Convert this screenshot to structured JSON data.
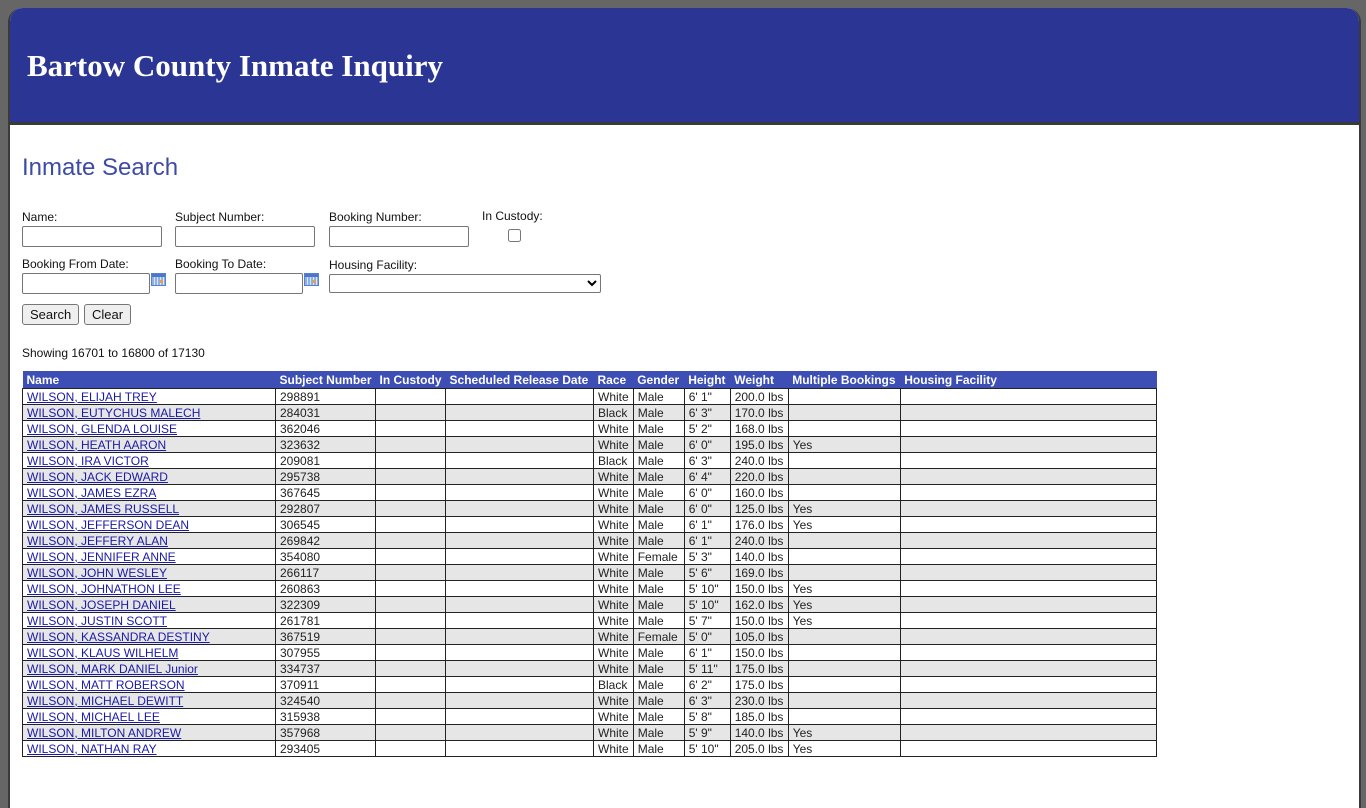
{
  "header": {
    "title": "Bartow County Inmate Inquiry"
  },
  "page_title": "Inmate Search",
  "form": {
    "name_label": "Name:",
    "name_value": "",
    "subject_label": "Subject Number:",
    "subject_value": "",
    "booking_label": "Booking Number:",
    "booking_value": "",
    "custody_label": "In Custody:",
    "custody_checked": false,
    "from_label": "Booking From Date:",
    "from_value": "",
    "to_label": "Booking To Date:",
    "to_value": "",
    "facility_label": "Housing Facility:",
    "facility_selected": "",
    "search_button": "Search",
    "clear_button": "Clear"
  },
  "showing": "Showing 16701 to 16800 of 17130",
  "table": {
    "columns": [
      "Name",
      "Subject Number",
      "In Custody",
      "Scheduled Release Date",
      "Race",
      "Gender",
      "Height",
      "Weight",
      "Multiple Bookings",
      "Housing Facility"
    ],
    "rows": [
      {
        "name": "WILSON, ELIJAH TREY",
        "subject": "298891",
        "custody": "",
        "release": "",
        "race": "White",
        "gender": "Male",
        "height": "6' 1\"",
        "weight": "200.0 lbs",
        "multiple": "",
        "facility": ""
      },
      {
        "name": "WILSON, EUTYCHUS MALECH",
        "subject": "284031",
        "custody": "",
        "release": "",
        "race": "Black",
        "gender": "Male",
        "height": "6' 3\"",
        "weight": "170.0 lbs",
        "multiple": "",
        "facility": ""
      },
      {
        "name": "WILSON, GLENDA LOUISE",
        "subject": "362046",
        "custody": "",
        "release": "",
        "race": "White",
        "gender": "Male",
        "height": "5' 2\"",
        "weight": "168.0 lbs",
        "multiple": "",
        "facility": ""
      },
      {
        "name": "WILSON, HEATH AARON",
        "subject": "323632",
        "custody": "",
        "release": "",
        "race": "White",
        "gender": "Male",
        "height": "6' 0\"",
        "weight": "195.0 lbs",
        "multiple": "Yes",
        "facility": ""
      },
      {
        "name": "WILSON, IRA VICTOR",
        "subject": "209081",
        "custody": "",
        "release": "",
        "race": "Black",
        "gender": "Male",
        "height": "6' 3\"",
        "weight": "240.0 lbs",
        "multiple": "",
        "facility": ""
      },
      {
        "name": "WILSON, JACK EDWARD",
        "subject": "295738",
        "custody": "",
        "release": "",
        "race": "White",
        "gender": "Male",
        "height": "6' 4\"",
        "weight": "220.0 lbs",
        "multiple": "",
        "facility": ""
      },
      {
        "name": "WILSON, JAMES EZRA",
        "subject": "367645",
        "custody": "",
        "release": "",
        "race": "White",
        "gender": "Male",
        "height": "6' 0\"",
        "weight": "160.0 lbs",
        "multiple": "",
        "facility": ""
      },
      {
        "name": "WILSON, JAMES RUSSELL",
        "subject": "292807",
        "custody": "",
        "release": "",
        "race": "White",
        "gender": "Male",
        "height": "6' 0\"",
        "weight": "125.0 lbs",
        "multiple": "Yes",
        "facility": ""
      },
      {
        "name": "WILSON, JEFFERSON DEAN",
        "subject": "306545",
        "custody": "",
        "release": "",
        "race": "White",
        "gender": "Male",
        "height": "6' 1\"",
        "weight": "176.0 lbs",
        "multiple": "Yes",
        "facility": ""
      },
      {
        "name": "WILSON, JEFFERY ALAN",
        "subject": "269842",
        "custody": "",
        "release": "",
        "race": "White",
        "gender": "Male",
        "height": "6' 1\"",
        "weight": "240.0 lbs",
        "multiple": "",
        "facility": ""
      },
      {
        "name": "WILSON, JENNIFER ANNE",
        "subject": "354080",
        "custody": "",
        "release": "",
        "race": "White",
        "gender": "Female",
        "height": "5' 3\"",
        "weight": "140.0 lbs",
        "multiple": "",
        "facility": ""
      },
      {
        "name": "WILSON, JOHN WESLEY",
        "subject": "266117",
        "custody": "",
        "release": "",
        "race": "White",
        "gender": "Male",
        "height": "5' 6\"",
        "weight": "169.0 lbs",
        "multiple": "",
        "facility": ""
      },
      {
        "name": "WILSON, JOHNATHON LEE",
        "subject": "260863",
        "custody": "",
        "release": "",
        "race": "White",
        "gender": "Male",
        "height": "5' 10\"",
        "weight": "150.0 lbs",
        "multiple": "Yes",
        "facility": ""
      },
      {
        "name": "WILSON, JOSEPH DANIEL",
        "subject": "322309",
        "custody": "",
        "release": "",
        "race": "White",
        "gender": "Male",
        "height": "5' 10\"",
        "weight": "162.0 lbs",
        "multiple": "Yes",
        "facility": ""
      },
      {
        "name": "WILSON, JUSTIN SCOTT",
        "subject": "261781",
        "custody": "",
        "release": "",
        "race": "White",
        "gender": "Male",
        "height": "5' 7\"",
        "weight": "150.0 lbs",
        "multiple": "Yes",
        "facility": ""
      },
      {
        "name": "WILSON, KASSANDRA DESTINY",
        "subject": "367519",
        "custody": "",
        "release": "",
        "race": "White",
        "gender": "Female",
        "height": "5' 0\"",
        "weight": "105.0 lbs",
        "multiple": "",
        "facility": ""
      },
      {
        "name": "WILSON, KLAUS WILHELM",
        "subject": "307955",
        "custody": "",
        "release": "",
        "race": "White",
        "gender": "Male",
        "height": "6' 1\"",
        "weight": "150.0 lbs",
        "multiple": "",
        "facility": ""
      },
      {
        "name": "WILSON, MARK DANIEL Junior",
        "subject": "334737",
        "custody": "",
        "release": "",
        "race": "White",
        "gender": "Male",
        "height": "5' 11\"",
        "weight": "175.0 lbs",
        "multiple": "",
        "facility": ""
      },
      {
        "name": "WILSON, MATT ROBERSON",
        "subject": "370911",
        "custody": "",
        "release": "",
        "race": "Black",
        "gender": "Male",
        "height": "6' 2\"",
        "weight": "175.0 lbs",
        "multiple": "",
        "facility": ""
      },
      {
        "name": "WILSON, MICHAEL DEWITT",
        "subject": "324540",
        "custody": "",
        "release": "",
        "race": "White",
        "gender": "Male",
        "height": "6' 3\"",
        "weight": "230.0 lbs",
        "multiple": "",
        "facility": ""
      },
      {
        "name": "WILSON, MICHAEL LEE",
        "subject": "315938",
        "custody": "",
        "release": "",
        "race": "White",
        "gender": "Male",
        "height": "5' 8\"",
        "weight": "185.0 lbs",
        "multiple": "",
        "facility": ""
      },
      {
        "name": "WILSON, MILTON ANDREW",
        "subject": "357968",
        "custody": "",
        "release": "",
        "race": "White",
        "gender": "Male",
        "height": "5' 9\"",
        "weight": "140.0 lbs",
        "multiple": "Yes",
        "facility": ""
      },
      {
        "name": "WILSON, NATHAN RAY",
        "subject": "293405",
        "custody": "",
        "release": "",
        "race": "White",
        "gender": "Male",
        "height": "5' 10\"",
        "weight": "205.0 lbs",
        "multiple": "Yes",
        "facility": ""
      }
    ]
  }
}
